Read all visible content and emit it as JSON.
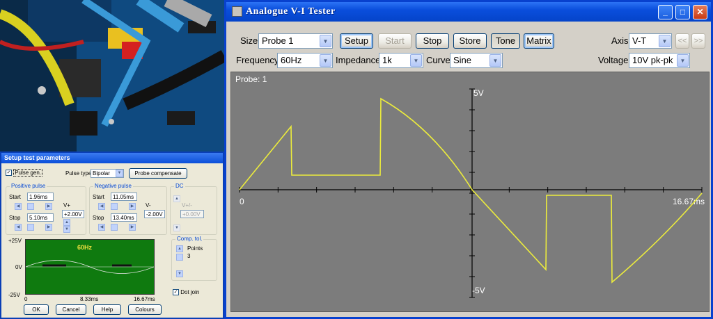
{
  "setup": {
    "title": "Setup test parameters",
    "pulse_gen_label": "Pulse gen.",
    "pulse_gen_checked": true,
    "pulse_type_label": "Pulse type",
    "pulse_type_value": "Bipolar",
    "probe_compensate_label": "Probe compensate",
    "positive_pulse": {
      "label": "Positive pulse",
      "start_label": "Start",
      "start": "1.96ms",
      "stop_label": "Stop",
      "stop": "5.10ms",
      "v_label": "V+",
      "v": "+2.00V"
    },
    "negative_pulse": {
      "label": "Negative pulse",
      "start_label": "Start",
      "start": "11.05ms",
      "stop_label": "Stop",
      "stop": "13.40ms",
      "v_label": "V-",
      "v": "-2.00V"
    },
    "dc": {
      "label": "DC",
      "v_label": "V+/-",
      "v": "+0.00V"
    },
    "preview": {
      "freq_label": "60Hz",
      "y_top": "+25V",
      "y_mid": "0V",
      "y_bot": "-25V",
      "x_start": "0",
      "x_mid": "8.33ms",
      "x_end": "16.67ms"
    },
    "comp_tol": {
      "label": "Comp. tol.",
      "points_label": "Points",
      "points": "3"
    },
    "dot_join_label": "Dot join",
    "dot_join_checked": true,
    "buttons": {
      "ok": "OK",
      "cancel": "Cancel",
      "help": "Help",
      "colours": "Colours"
    }
  },
  "main": {
    "title": "Analogue V-I Tester",
    "size_label": "Size",
    "size_value": "Probe 1",
    "buttons": {
      "setup": "Setup",
      "start": "Start",
      "stop": "Stop",
      "store": "Store",
      "tone": "Tone",
      "matrix": "Matrix"
    },
    "axis_label": "Axis",
    "axis_value": "V-T",
    "nav_prev": "<<",
    "nav_next": ">>",
    "frequency_label": "Frequency",
    "frequency_value": "60Hz",
    "impedance_label": "Impedance",
    "impedance_value": "1k",
    "curve_label": "Curve",
    "curve_value": "Sine",
    "voltage_label": "Voltage",
    "voltage_value": "10V pk-pk",
    "scope": {
      "probe_label": "Probe: 1",
      "y_top": "5V",
      "y_bot": "-5V",
      "x_start": "0",
      "x_end": "16.67ms",
      "trace_color": "#ecec3c"
    }
  }
}
